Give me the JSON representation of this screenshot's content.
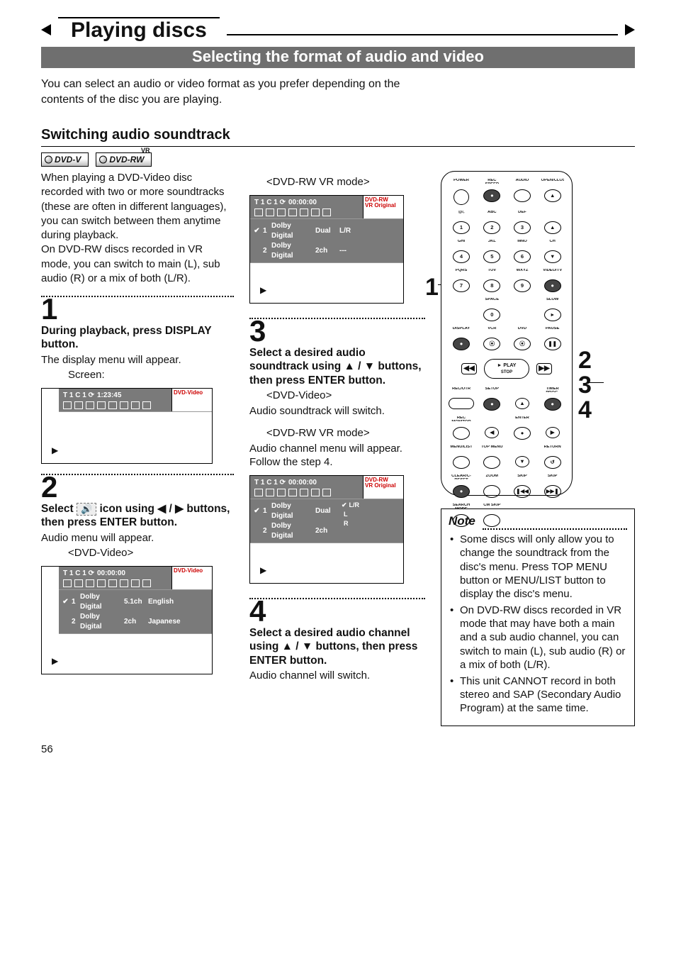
{
  "header": {
    "title": "Playing discs",
    "section_band": "Selecting the format of audio and video",
    "intro": "You can select an audio or video format as you prefer depending on the contents of the disc you are playing.",
    "subhead": "Switching audio soundtrack"
  },
  "badges": {
    "dvd_v": "DVD-V",
    "dvd_rw": "DVD-RW",
    "vr": "VR"
  },
  "left": {
    "body": "When playing a DVD-Video disc recorded with two or more soundtracks (these are often in different languages), you can switch between them anytime during playback.\nOn DVD-RW discs recorded in VR mode, you can switch to main (L), sub audio (R) or a mix of both (L/R).",
    "step1_num": "1",
    "step1_head": "During playback, press DISPLAY button.",
    "step1_body": "The display menu will appear.",
    "step1_screen_label": "Screen:",
    "step2_num": "2",
    "step2_head_a": "Select ",
    "step2_icon_text": "🔊",
    "step2_head_b": " icon using ◀ / ▶ buttons, then press ENTER button.",
    "step2_body": "Audio menu will appear.",
    "step2_mode_label": "<DVD-Video>"
  },
  "mid": {
    "mode_label_vr": "<DVD-RW VR mode>",
    "step3_num": "3",
    "step3_head": "Select a desired audio soundtrack using ▲ / ▼ buttons, then press ENTER button.",
    "step3_sub_video_label": "<DVD-Video>",
    "step3_sub_video_body": "Audio soundtrack will switch.",
    "step3_sub_vr_label": "<DVD-RW VR mode>",
    "step3_sub_vr_body": "Audio channel menu will appear. Follow the step 4.",
    "step4_num": "4",
    "step4_head": "Select a desired audio channel using ▲ / ▼ buttons, then press ENTER button.",
    "step4_body": "Audio channel will switch."
  },
  "osd": {
    "info_row1": "T   1  C   1  ⟳   ",
    "time_video": "1:23:45",
    "time_rw": "00:00:00",
    "disctype_video": "DVD-Video",
    "disctype_rw1": "DVD-RW",
    "disctype_rw2": "VR Original",
    "play_glyph": "▶",
    "audio_menu_video": [
      {
        "chk": "✔",
        "idx": "1",
        "name": "Dolby Digital",
        "ch": "5.1ch",
        "lang": "English"
      },
      {
        "chk": "",
        "idx": "2",
        "name": "Dolby Digital",
        "ch": "2ch",
        "lang": "Japanese"
      }
    ],
    "audio_menu_rw": [
      {
        "chk": "✔",
        "idx": "1",
        "name": "Dolby Digital",
        "ch": "Dual",
        "lang": "L/R"
      },
      {
        "chk": "",
        "idx": "2",
        "name": "Dolby Digital",
        "ch": "2ch",
        "lang": "---"
      }
    ],
    "audio_side_rw": [
      {
        "chk": "✔",
        "v": "L/R"
      },
      {
        "chk": "",
        "v": "L"
      },
      {
        "chk": "",
        "v": "R"
      }
    ]
  },
  "remote": {
    "row_labels_1": [
      "POWER",
      "REC SPEED",
      "AUDIO",
      "OPEN/CLOSE"
    ],
    "row_btns_1": [
      "",
      "●",
      "",
      "▲"
    ],
    "row_labels_2": [
      "@/,",
      "ABC",
      "DEF",
      ""
    ],
    "row_btns_2": [
      "1",
      "2",
      "3",
      "▲"
    ],
    "row_labels_3": [
      "GHI",
      "JKL",
      "MNO",
      "CH"
    ],
    "row_btns_3": [
      "4",
      "5",
      "6",
      "▼"
    ],
    "row_labels_4": [
      "PQRS",
      "TUV",
      "WXYZ",
      "VIDEO/TV"
    ],
    "row_btns_4": [
      "7",
      "8",
      "9",
      "●"
    ],
    "row_labels_5": [
      "",
      "SPACE",
      "",
      "SLOW"
    ],
    "row_btns_5": [
      "",
      "0",
      "",
      "▸"
    ],
    "row_labels_6": [
      "DISPLAY",
      "VCR",
      "DVD",
      "PAUSE"
    ],
    "row_btns_6": [
      "●",
      "⦿",
      "⦿",
      "❚❚"
    ],
    "nav_play": "PLAY",
    "nav_play_glyph": "►",
    "nav_stop": "STOP",
    "nav_rew": "◀◀",
    "nav_ffw": "▶▶",
    "row_labels_7": [
      "REC/OTR",
      "SETUP",
      "",
      "TIMER PROG."
    ],
    "row_btns_7": [
      "",
      "●",
      "▲",
      "●"
    ],
    "row_labels_8": [
      "REC MONITOR",
      "",
      "ENTER",
      ""
    ],
    "row_btns_8": [
      "",
      "◀",
      "●",
      "▶"
    ],
    "row_labels_9": [
      "MENU/LIST",
      "TOP MENU",
      "",
      "RETURN"
    ],
    "row_btns_9": [
      "",
      "",
      "▼",
      "↺"
    ],
    "row_labels_10": [
      "CLEAR/C-RESET",
      "ZOOM",
      "SKIP",
      "SKIP"
    ],
    "row_btns_10": [
      "●",
      "",
      "❚◀◀",
      "▶▶❚"
    ],
    "row_labels_11": [
      "SEARCH MODE",
      "CM SKIP",
      "",
      ""
    ],
    "row_btns_11": [
      "",
      "",
      "",
      ""
    ]
  },
  "right_nums": {
    "one": "1",
    "two": "2",
    "three": "3",
    "four": "4"
  },
  "note": {
    "title": "Note",
    "items": [
      "Some discs will only allow you to change the soundtrack from the disc's menu. Press TOP MENU button or MENU/LIST button to display the disc's menu.",
      "On DVD-RW discs recorded in VR mode that may have both a main and a sub audio channel, you can switch to main (L), sub audio (R) or a mix of both (L/R).",
      "This unit CANNOT record in both stereo and SAP (Secondary Audio Program) at the same time."
    ]
  },
  "page_number": "56"
}
